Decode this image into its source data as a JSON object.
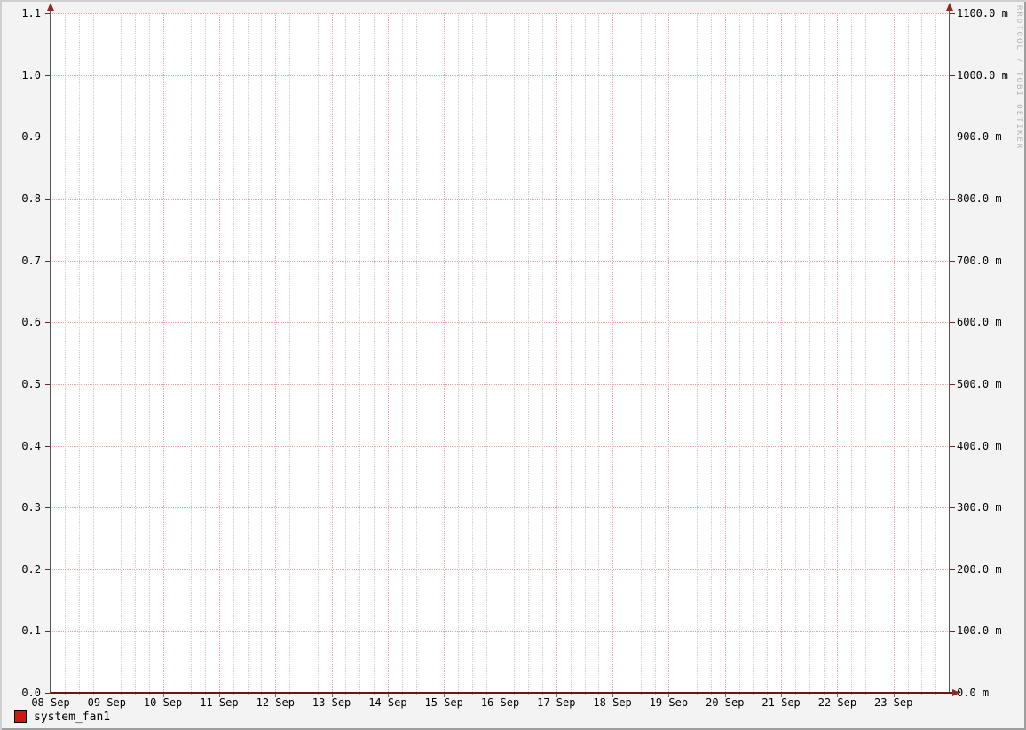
{
  "watermark": {
    "text": "RRDTOOL / TOBI OETIKER"
  },
  "legend": {
    "items": [
      {
        "label": "system_fan1",
        "color": "#cc1a10"
      }
    ]
  },
  "chart_data": {
    "type": "line",
    "title": "",
    "xlabel": "",
    "ylabel": "",
    "x_axis": {
      "tick_labels": [
        "08 Sep",
        "09 Sep",
        "10 Sep",
        "11 Sep",
        "12 Sep",
        "13 Sep",
        "14 Sep",
        "15 Sep",
        "16 Sep",
        "17 Sep",
        "18 Sep",
        "19 Sep",
        "20 Sep",
        "21 Sep",
        "22 Sep",
        "23 Sep"
      ],
      "days_shown": 16,
      "minor_divisions_per_day": 4
    },
    "left_axis": {
      "min": 0.0,
      "max": 1.1,
      "tick_step": 0.1,
      "tick_labels": [
        "0.0",
        "0.1",
        "0.2",
        "0.3",
        "0.4",
        "0.5",
        "0.6",
        "0.7",
        "0.8",
        "0.9",
        "1.0",
        "1.1"
      ]
    },
    "right_axis": {
      "scale_note": "left value x 1000 (milli)",
      "tick_labels": [
        "0.0 m",
        "100.0 m",
        "200.0 m",
        "300.0 m",
        "400.0 m",
        "500.0 m",
        "600.0 m",
        "700.0 m",
        "800.0 m",
        "900.0 m",
        "1000.0 m",
        "1100.0 m"
      ]
    },
    "series": [
      {
        "name": "system_fan1",
        "color": "#cc1a10",
        "values": [
          0,
          0,
          0,
          0,
          0,
          0,
          0,
          0,
          0,
          0,
          0,
          0,
          0,
          0,
          0,
          0
        ]
      }
    ],
    "grid": {
      "on": true,
      "major_color": "#efa2a0",
      "minor_color": "#cfcfcf"
    },
    "legend_position": "bottom-left"
  },
  "colors": {
    "background": "#f3f3f3",
    "canvas": "#ffffff",
    "border_light": "#cfcfcf",
    "border_dark": "#9e9e9e",
    "axis_line": "#555555",
    "arrow": "#8b2a24",
    "x_axis_line": "#701414",
    "text": "#000000",
    "watermark_text": "#b4b4b4"
  }
}
